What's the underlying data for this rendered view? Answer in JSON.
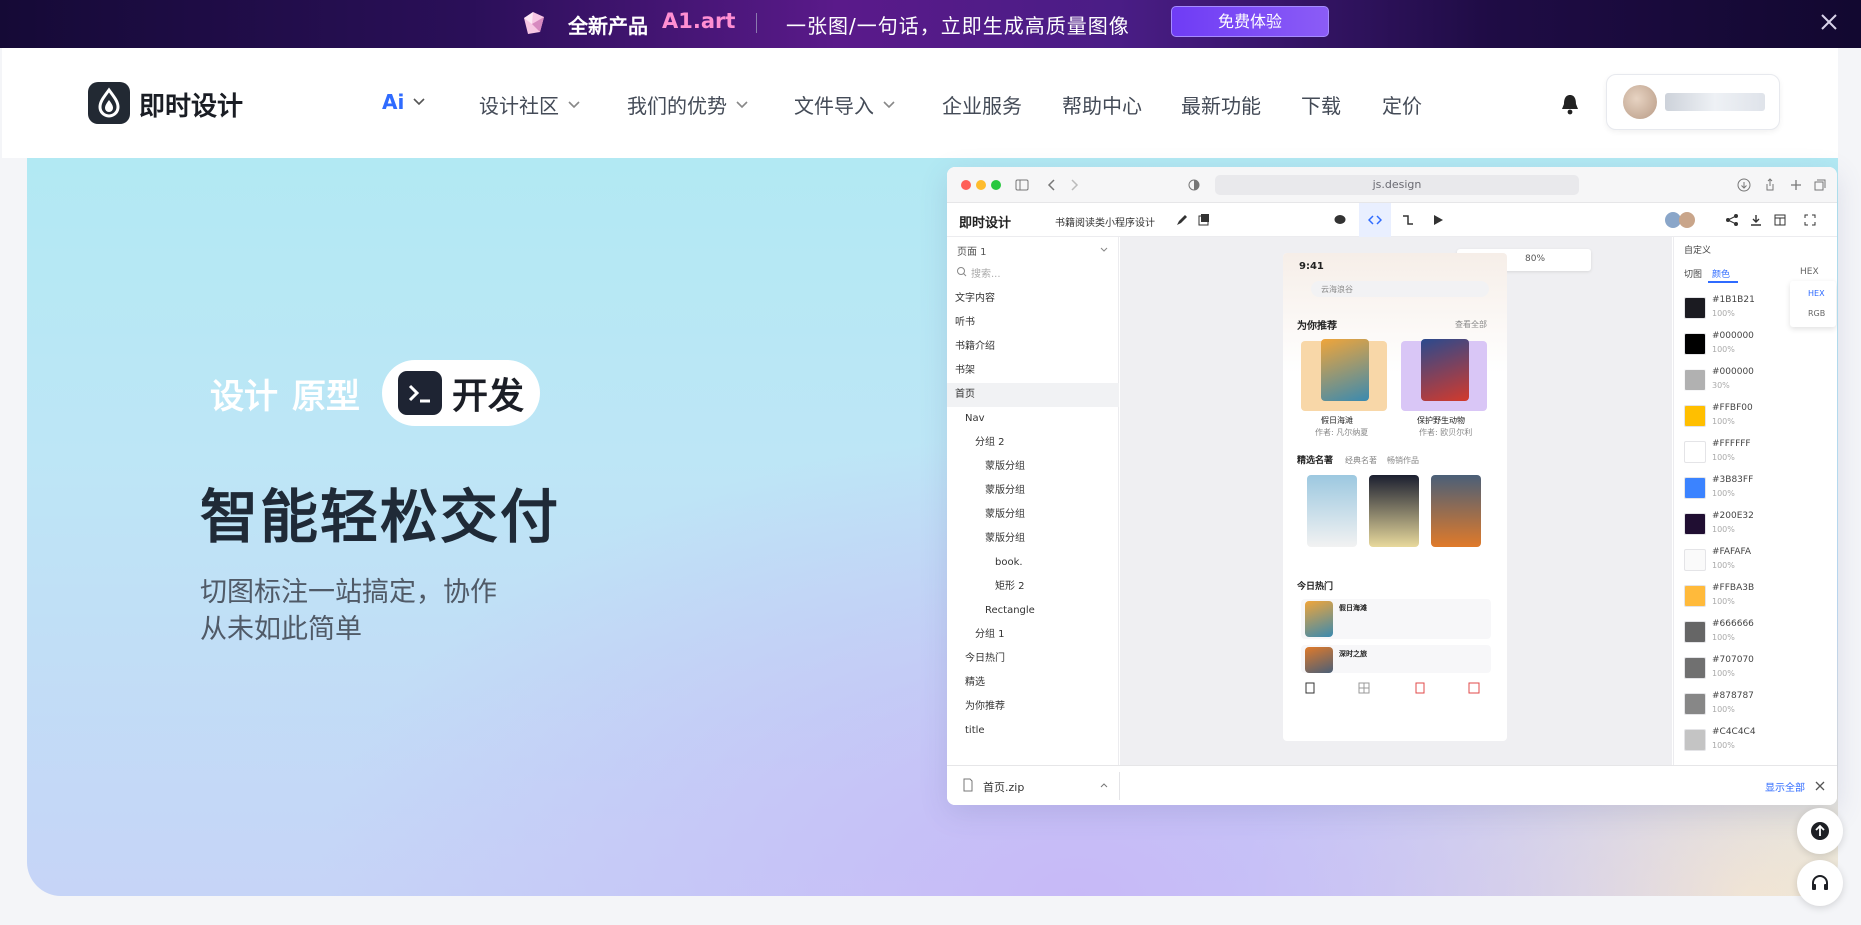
{
  "promo": {
    "new_label": "全新产品",
    "product": "A1.art",
    "tagline": "一张图/一句话，立即生成高质量图像",
    "cta": "免费体验"
  },
  "nav": {
    "brand": "即时设计",
    "items": [
      {
        "label": "Ai",
        "dropdown": true
      },
      {
        "label": "设计社区",
        "dropdown": true
      },
      {
        "label": "我们的优势",
        "dropdown": true
      },
      {
        "label": "文件导入",
        "dropdown": true
      },
      {
        "label": "企业服务",
        "dropdown": false
      },
      {
        "label": "帮助中心",
        "dropdown": false
      },
      {
        "label": "最新功能",
        "dropdown": false
      },
      {
        "label": "下载",
        "dropdown": false
      },
      {
        "label": "定价",
        "dropdown": false
      }
    ]
  },
  "hero": {
    "tag1": "设计",
    "tag2": "原型",
    "tag3": "开发",
    "title": "智能轻松交付",
    "subtitle_line1": "切图标注一站搞定，协作",
    "subtitle_line2": "从未如此简单"
  },
  "mock": {
    "url": "js.design",
    "brand": "即时设计",
    "project": "书籍阅读类小程序设计",
    "page_select": "页面 1",
    "search_placeholder": "搜索...",
    "layers": [
      "文字内容",
      "听书",
      "书籍介绍",
      "书架",
      "首页",
      "Nav",
      "分组 2",
      "蒙版分组",
      "蒙版分组",
      "蒙版分组",
      "蒙版分组",
      "book.",
      "矩形 2",
      "Rectangle",
      "分组 1",
      "今日热门",
      "精选",
      "为你推荐",
      "title"
    ],
    "zoom": "80%",
    "phone": {
      "time": "9:41",
      "search": "云海浪谷",
      "sec1": "为你推荐",
      "see_all": "查看全部",
      "book1_title": "假日海滩",
      "book1_author": "作者: 凡尔纳夏",
      "book2_title": "保护野生动物",
      "book2_author": "作者: 欧贝尔利",
      "sec2": "精选名著",
      "sec2_tab2": "经典名著",
      "sec2_tab3": "畅销作品",
      "sec3": "今日热门",
      "hot1_title": "假日海滩",
      "hot2_title": "深时之旅"
    },
    "right": {
      "header": "自定义",
      "tab1": "切图",
      "tab2": "颜色",
      "format": "HEX",
      "format_opt1": "HEX",
      "format_opt2": "RGB",
      "colors": [
        {
          "hex": "#1B1B21",
          "pct": "100%"
        },
        {
          "hex": "#000000",
          "pct": "100%"
        },
        {
          "hex": "#000000",
          "pct": "30%"
        },
        {
          "hex": "#FFBF00",
          "pct": "100%"
        },
        {
          "hex": "#FFFFFF",
          "pct": "100%"
        },
        {
          "hex": "#3B83FF",
          "pct": "100%"
        },
        {
          "hex": "#200E32",
          "pct": "100%"
        },
        {
          "hex": "#FAFAFA",
          "pct": "100%"
        },
        {
          "hex": "#FFBA3B",
          "pct": "100%"
        },
        {
          "hex": "#666666",
          "pct": "100%"
        },
        {
          "hex": "#707070",
          "pct": "100%"
        },
        {
          "hex": "#878787",
          "pct": "100%"
        },
        {
          "hex": "#C4C4C4",
          "pct": "100%"
        }
      ]
    },
    "download_file": "首页.zip",
    "show_all": "显示全部"
  },
  "colors": {
    "accent": "#2F6BFF",
    "title": "#1F2A37",
    "promo_pink": "#FF8FD2"
  }
}
